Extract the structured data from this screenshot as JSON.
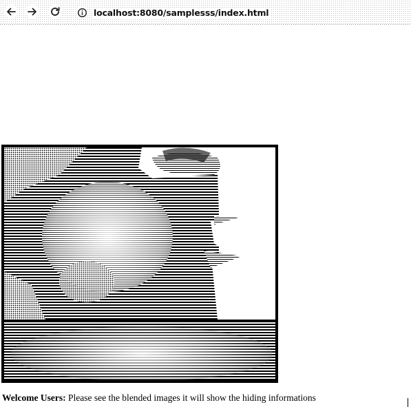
{
  "browser": {
    "url": "localhost:8080/samplesss/index.html",
    "icons": {
      "back": "arrow-left-icon",
      "forward": "arrow-right-icon",
      "reload": "reload-icon",
      "site_info": "info-icon"
    }
  },
  "page": {
    "caption_label": "Welcome Users:",
    "caption_text": " Please see the blended images it will show the hiding informations"
  }
}
